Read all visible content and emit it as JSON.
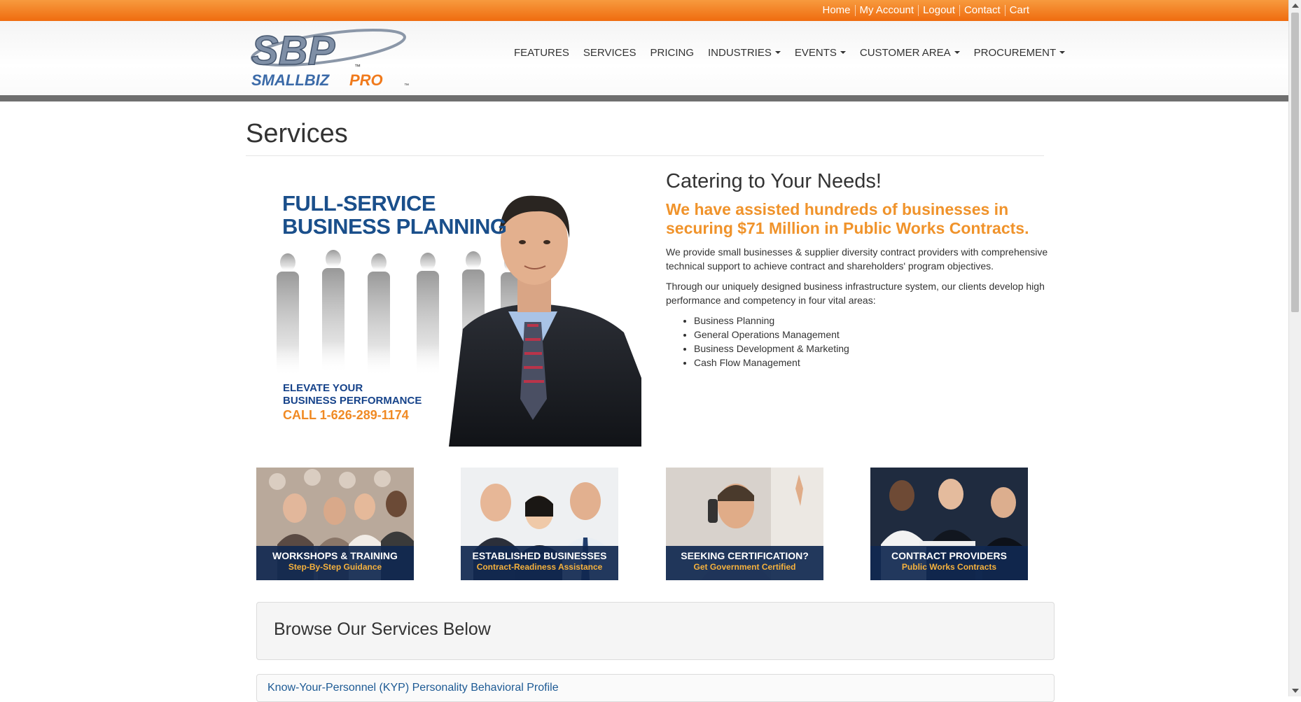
{
  "colors": {
    "accent_orange": "#ef6c0f",
    "brand_blue": "#1a4f8b",
    "highlight_orange": "#f0932b"
  },
  "top_links": [
    "Home",
    "My Account",
    "Logout",
    "Contact",
    "Cart"
  ],
  "logo": {
    "mark": "SBP",
    "name_small_biz": "SMALLBIZ",
    "name_pro": "PRO",
    "tm": "™"
  },
  "nav": [
    {
      "label": "FEATURES",
      "dropdown": false
    },
    {
      "label": "SERVICES",
      "dropdown": false
    },
    {
      "label": "PRICING",
      "dropdown": false
    },
    {
      "label": "INDUSTRIES",
      "dropdown": true
    },
    {
      "label": "EVENTS",
      "dropdown": true
    },
    {
      "label": "CUSTOMER AREA",
      "dropdown": true
    },
    {
      "label": "PROCUREMENT",
      "dropdown": true
    }
  ],
  "page": {
    "title": "Services"
  },
  "hero": {
    "headline_1": "FULL-SERVICE",
    "headline_2": "BUSINESS PLANNING",
    "sub_1": "ELEVATE YOUR",
    "sub_2": "BUSINESS PERFORMANCE",
    "call": "CALL 1-626-289-1174"
  },
  "intro": {
    "title": "Catering to Your Needs!",
    "highlight": "We have assisted hundreds of businesses in securing $71 Million in Public Works Contracts.",
    "para_1": "We provide small businesses & supplier diversity contract providers with comprehensive technical support to achieve contract and shareholders' program objectives.",
    "para_2": "Through our uniquely designed business infrastructure system, our clients develop high performance and competency in four vital areas:",
    "areas": [
      "Business Planning",
      "General Operations Management",
      "Business Development & Marketing",
      "Cash Flow Management"
    ]
  },
  "cards": [
    {
      "title": "WORKSHOPS & TRAINING",
      "subtitle": "Step-By-Step Guidance"
    },
    {
      "title": "ESTABLISHED BUSINESSES",
      "subtitle": "Contract-Readiness Assistance"
    },
    {
      "title": "SEEKING CERTIFICATION?",
      "subtitle": "Get Government Certified"
    },
    {
      "title": "CONTRACT PROVIDERS",
      "subtitle": "Public Works Contracts"
    }
  ],
  "browse": {
    "title": "Browse Our Services Below",
    "first_service": "Know-Your-Personnel (KYP) Personality Behavioral Profile"
  }
}
